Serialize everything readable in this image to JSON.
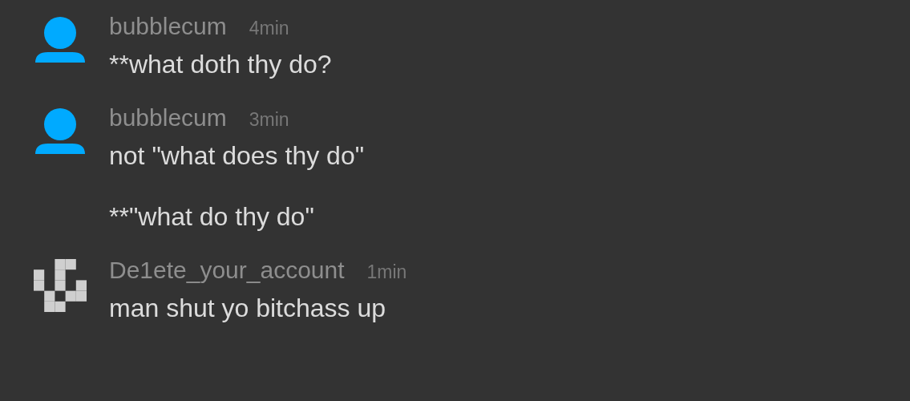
{
  "comments": [
    {
      "avatar": {
        "kind": "silhouette"
      },
      "username": "bubblecum",
      "time": "4min",
      "messages": [
        "**what doth thy do?"
      ]
    },
    {
      "avatar": {
        "kind": "silhouette"
      },
      "username": "bubblecum",
      "time": "3min",
      "messages": [
        "not \"what does thy do\"",
        "**\"what do thy do\""
      ]
    },
    {
      "avatar": {
        "kind": "pixel"
      },
      "username": "De1ete_your_account",
      "time": "1min",
      "messages": [
        "man shut yo bitchass up"
      ]
    }
  ]
}
